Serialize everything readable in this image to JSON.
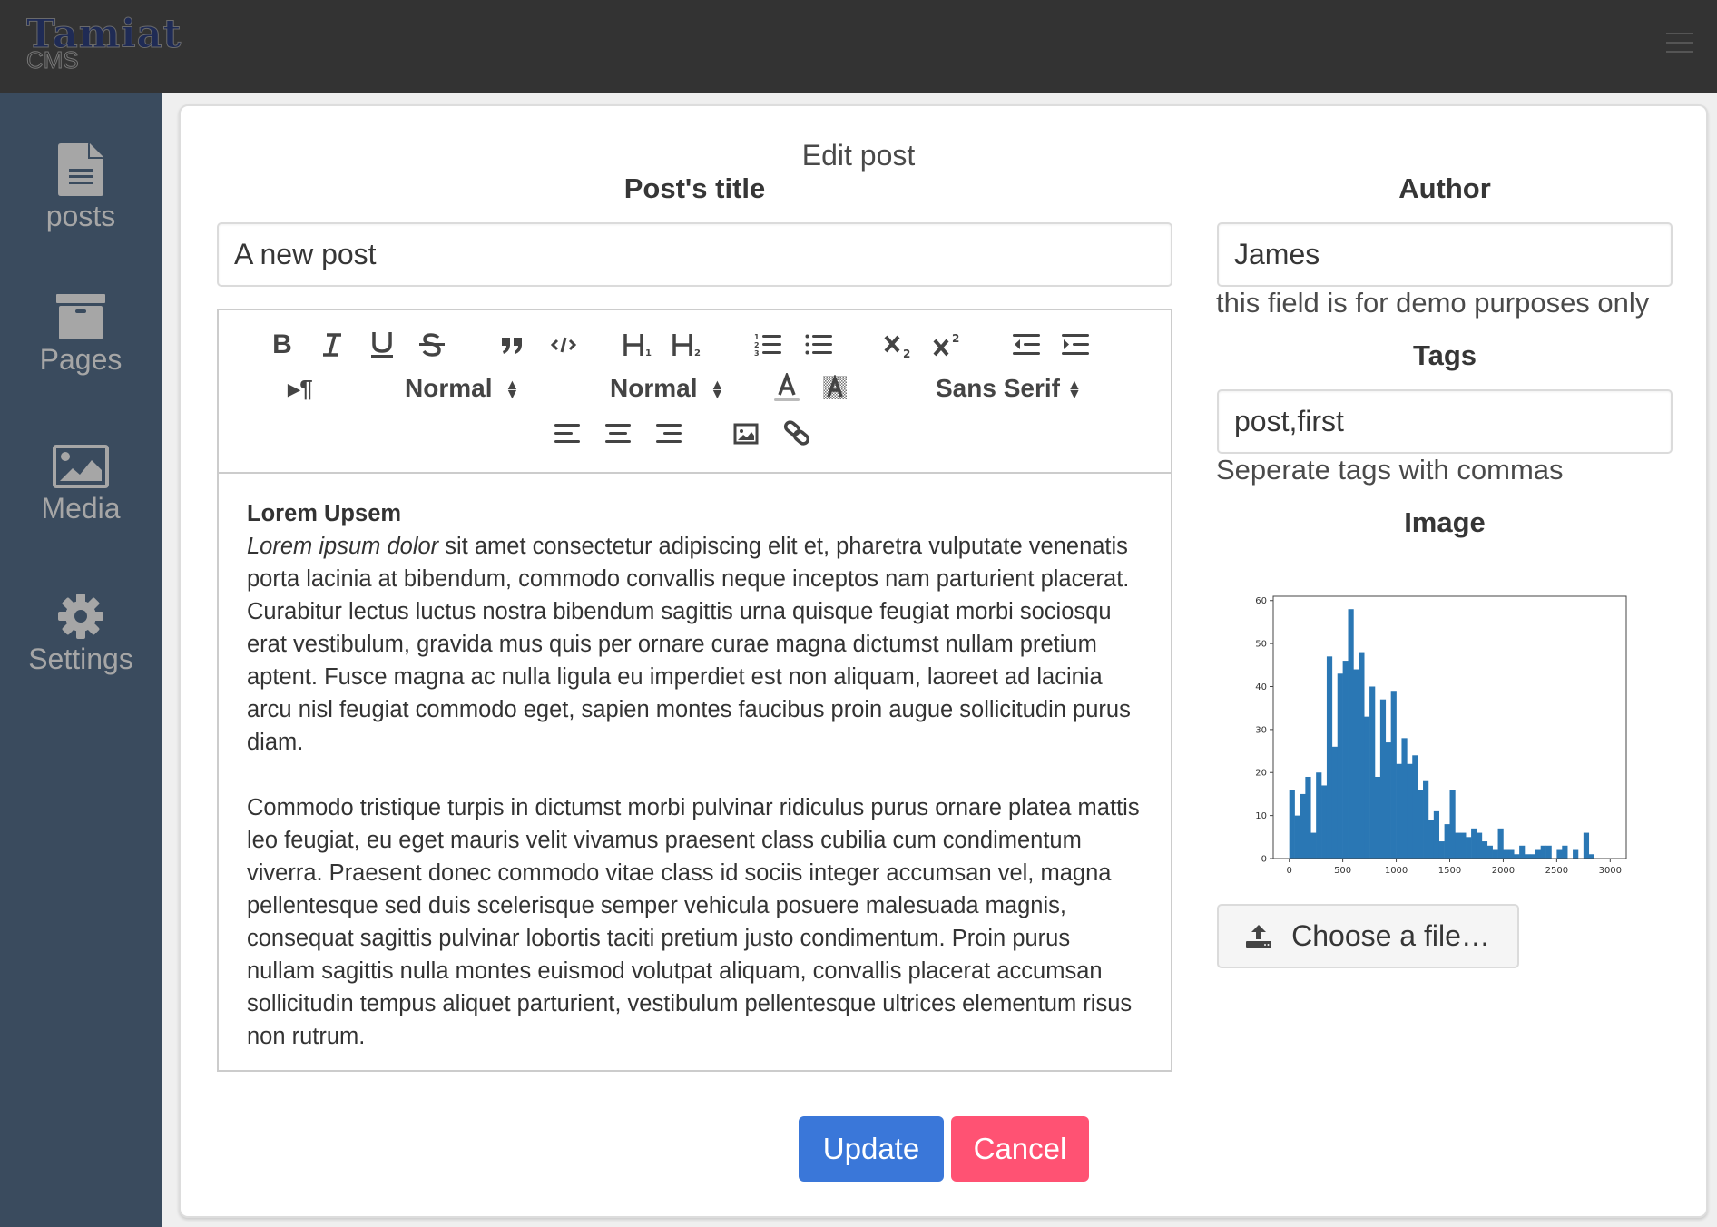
{
  "app": {
    "logo_main": "Tamiat",
    "logo_sub": "CMS",
    "menu_icon": "hamburger-icon"
  },
  "sidebar": {
    "items": [
      {
        "label": "posts",
        "icon": "file-text-icon"
      },
      {
        "label": "Pages",
        "icon": "archive-icon"
      },
      {
        "label": "Media",
        "icon": "image-icon"
      },
      {
        "label": "Settings",
        "icon": "gear-icon"
      }
    ]
  },
  "page": {
    "title": "Edit post"
  },
  "form": {
    "title_label": "Post's title",
    "title_value": "A new post",
    "author_label": "Author",
    "author_value": "James",
    "author_help": "this field is for demo purposes only",
    "tags_label": "Tags",
    "tags_value": "post,first",
    "tags_help": "Seperate tags with commas",
    "image_label": "Image",
    "file_button": "Choose a file…",
    "update_button": "Update",
    "cancel_button": "Cancel"
  },
  "toolbar": {
    "buttons": [
      "bold",
      "italic",
      "underline",
      "strike",
      "blockquote",
      "code-block",
      "header-1",
      "header-2",
      "ordered-list",
      "bullet-list",
      "subscript",
      "superscript",
      "outdent",
      "indent",
      "direction",
      "color",
      "background",
      "align-left",
      "align-center",
      "align-right",
      "image",
      "link"
    ],
    "size_picker": "Normal",
    "header_picker": "Normal",
    "font_picker": "Sans Serif"
  },
  "editor": {
    "heading": "Lorem Upsem",
    "p1_italic": "Lorem ipsum dolor",
    "p1_rest": " sit amet consectetur adipiscing elit et, pharetra vulputate venenatis porta lacinia at bibendum, commodo convallis neque inceptos nam parturient placerat. Curabitur lectus luctus nostra bibendum sagittis urna quisque feugiat morbi sociosqu erat vestibulum, gravida mus quis per ornare curae magna dictumst nullam pretium aptent. Fusce magna ac nulla ligula eu imperdiet est non aliquam, laoreet ad lacinia arcu nisl feugiat commodo eget, sapien montes faucibus proin augue sollicitudin purus diam.",
    "p2": "Commodo tristique turpis in dictumst morbi pulvinar ridiculus purus ornare platea mattis leo feugiat, eu eget mauris velit vivamus praesent class cubilia cum condimentum viverra. Praesent donec commodo vitae class id sociis integer accumsan vel, magna pellentesque sed duis scelerisque semper vehicula posuere malesuada magnis, consequat sagittis pulvinar lobortis taciti pretium justo condimentum. Proin purus nullam sagittis nulla montes euismod volutpat aliquam, convallis placerat accumsan sollicitudin tempus aliquet parturient, vestibulum pellentesque ultrices elementum risus non rutrum."
  },
  "colors": {
    "update": "#3273dc",
    "cancel": "#ff3860",
    "sidebar": "#3a4b5e",
    "topbar": "#333333",
    "bar": "#2a77b4"
  },
  "chart_data": {
    "type": "bar",
    "title": "",
    "xlabel": "",
    "ylabel": "",
    "bin_width": 50,
    "bin_start": 0,
    "values": [
      16,
      10,
      15,
      19,
      6,
      20,
      17,
      47,
      26,
      43,
      46,
      58,
      44,
      48,
      33,
      40,
      19,
      37,
      27,
      39,
      22,
      28,
      22,
      24,
      16,
      18,
      9,
      11,
      4,
      8,
      16,
      6,
      6,
      5,
      7,
      6,
      4,
      3,
      2,
      7,
      2,
      2,
      1,
      3,
      1,
      1,
      2,
      3,
      3,
      0,
      2,
      3,
      0,
      2,
      0,
      6,
      1
    ],
    "xlim": [
      -150,
      3150
    ],
    "ylim": [
      0,
      61
    ],
    "xticks": [
      0,
      500,
      1000,
      1500,
      2000,
      2500,
      3000
    ],
    "yticks": [
      0,
      10,
      20,
      30,
      40,
      50,
      60
    ],
    "grid": false,
    "legend": "none"
  }
}
